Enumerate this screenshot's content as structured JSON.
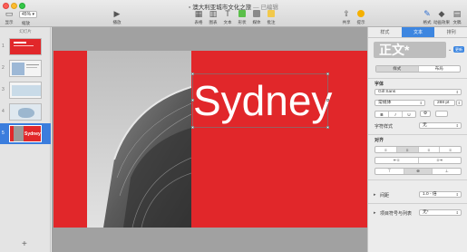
{
  "window": {
    "title": "澳大利亚城市文化之旅",
    "edited": "— 已编辑"
  },
  "toolbar": {
    "view_label": "显示",
    "zoom_value": "45%",
    "zoom_label": "缩放",
    "play_label": "播放",
    "table_label": "表格",
    "chart_label": "图表",
    "text_label": "文本",
    "shape_label": "形状",
    "media_label": "媒体",
    "comment_label": "批注",
    "share_label": "共享",
    "tips_label": "提示",
    "format_label": "格式",
    "animate_label": "动画效果",
    "document_label": "文稿"
  },
  "navigator": {
    "header": "幻灯片",
    "slides": [
      {
        "number": "1"
      },
      {
        "number": "2"
      },
      {
        "number": "3"
      },
      {
        "number": "4"
      },
      {
        "number": "5",
        "thumb_text": "Sydney"
      }
    ],
    "add_label": "+"
  },
  "slide": {
    "title_text": "Sydney",
    "background_color": "#e1272a"
  },
  "inspector": {
    "tabs": [
      "样式",
      "文本",
      "排列"
    ],
    "active_tab": "文本",
    "paragraph_style": "正文*",
    "update_label": "更新",
    "subtabs": [
      "样式",
      "布局"
    ],
    "font_section": "字体",
    "font_name": "Gill Sans",
    "font_weight": "常规体",
    "font_size": "288 pt",
    "format_buttons": [
      "B",
      "I",
      "U"
    ],
    "char_style_label": "字符样式",
    "char_style_value": "无",
    "align_section": "对齐",
    "spacing_label": "间距",
    "spacing_value": "1.0 - 倍",
    "bullets_label": "项目符号与列表",
    "bullets_value": "无*"
  }
}
